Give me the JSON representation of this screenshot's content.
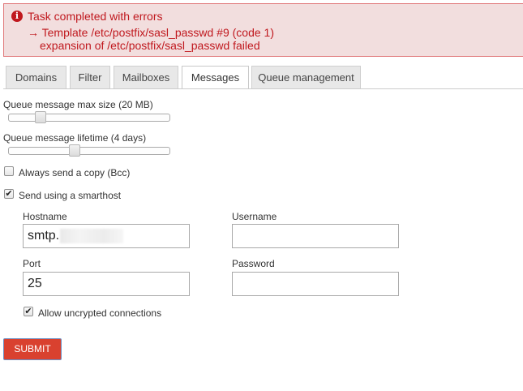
{
  "alert": {
    "icon": "info-icon",
    "title": "Task completed with errors",
    "line1": "→ Template /etc/postfix/sasl_passwd #9 (code 1)",
    "line2": "expansion of /etc/postfix/sasl_passwd failed",
    "color": "#c0181e",
    "background": "#f2dede"
  },
  "tabs": [
    {
      "label": "Domains"
    },
    {
      "label": "Filter"
    },
    {
      "label": "Mailboxes"
    },
    {
      "label": "Messages"
    },
    {
      "label": "Queue management"
    }
  ],
  "active_tab": "Messages",
  "settings": {
    "max_size_label": "Queue message max size (20 MB)",
    "max_size_level": 0.17,
    "lifetime_label": "Queue message lifetime (4 days)",
    "lifetime_level": 0.4,
    "bcc_label": "Always send a copy (Bcc)",
    "bcc_checked": false,
    "smarthost_label": "Send using a smarthost",
    "smarthost_checked": true
  },
  "smarthost": {
    "hostname_label": "Hostname",
    "hostname_value": "smtp.",
    "username_label": "Username",
    "username_value": "",
    "port_label": "Port",
    "port_value": "25",
    "password_label": "Password",
    "password_value": "",
    "unencrypted_label": "Allow uncrypted connections",
    "unencrypted_checked": true
  },
  "submit_label": "SUBMIT",
  "colors": {
    "submit": "#d9412f",
    "accent_border": "#6b8fc4"
  }
}
